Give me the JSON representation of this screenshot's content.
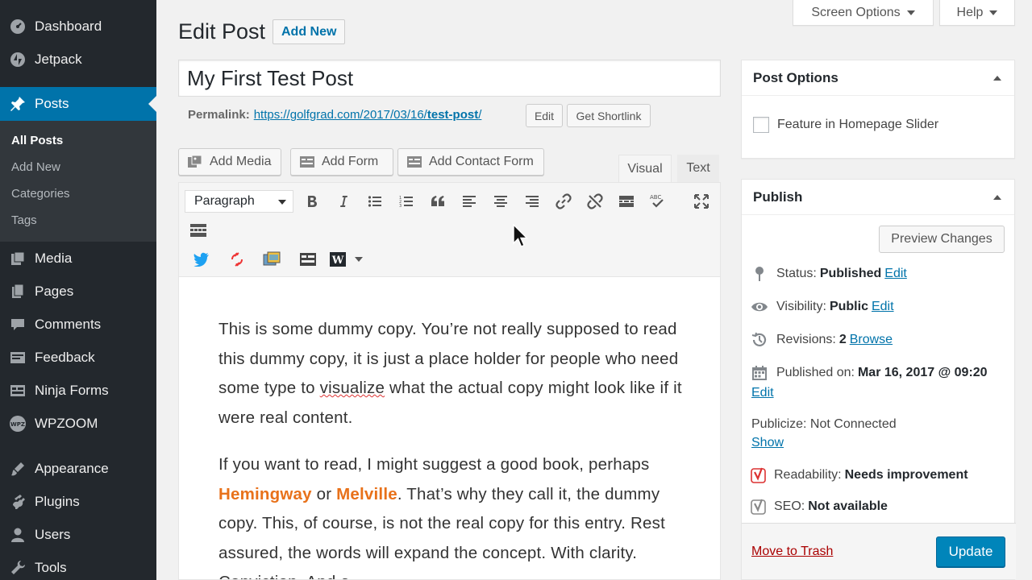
{
  "sidebar": {
    "items": [
      {
        "label": "Dashboard",
        "icon": "dashboard-icon"
      },
      {
        "label": "Jetpack",
        "icon": "jetpack-icon"
      },
      {
        "label": "Posts",
        "icon": "pin-icon"
      },
      {
        "label": "Media",
        "icon": "media-icon"
      },
      {
        "label": "Pages",
        "icon": "pages-icon"
      },
      {
        "label": "Comments",
        "icon": "comments-icon"
      },
      {
        "label": "Feedback",
        "icon": "feedback-icon"
      },
      {
        "label": "Ninja Forms",
        "icon": "forms-icon"
      },
      {
        "label": "WPZOOM",
        "icon": "wpzoom-icon"
      },
      {
        "label": "Appearance",
        "icon": "appearance-icon"
      },
      {
        "label": "Plugins",
        "icon": "plugins-icon"
      },
      {
        "label": "Users",
        "icon": "users-icon"
      },
      {
        "label": "Tools",
        "icon": "tools-icon"
      }
    ],
    "submenu": [
      "All Posts",
      "Add New",
      "Categories",
      "Tags"
    ]
  },
  "topbar": {
    "screen_options": "Screen Options",
    "help": "Help"
  },
  "header": {
    "title": "Edit Post",
    "add_new": "Add New"
  },
  "post": {
    "title": "My First Test Post",
    "permalink_label": "Permalink:",
    "permalink_base": "https://golfgrad.com/2017/03/16/",
    "permalink_slug": "test-post",
    "permalink_end": "/",
    "edit_btn": "Edit",
    "shortlink_btn": "Get Shortlink"
  },
  "media_buttons": {
    "add_media": "Add Media",
    "add_form": "Add Form",
    "add_contact_form": "Add Contact Form"
  },
  "editor_tabs": {
    "visual": "Visual",
    "text": "Text"
  },
  "toolbar": {
    "format": "Paragraph",
    "wp_label": "W"
  },
  "content": {
    "p1_a": "This is some dummy copy. You’re not really supposed to read this dummy copy, it is just a place holder for people who need some type to ",
    "p1_squiggle": "visualize",
    "p1_b": " what the actual copy might look like if it were real content.",
    "p2_a": "If you want to read, I might suggest a good book, perhaps ",
    "p2_hem": "Hemingway",
    "p2_or": " or ",
    "p2_mel": "Melville",
    "p2_b": ". That’s why they call it, the dummy copy. This, of course, is not the real copy for this entry. Rest assured, the words will expand the concept. With clarity. Conviction. And a"
  },
  "post_options": {
    "title": "Post Options",
    "feature_label": "Feature in Homepage Slider"
  },
  "publish": {
    "title": "Publish",
    "preview": "Preview Changes",
    "status_label": "Status:",
    "status_value": "Published",
    "status_edit": "Edit",
    "visibility_label": "Visibility:",
    "visibility_value": "Public",
    "visibility_edit": "Edit",
    "revisions_label": "Revisions:",
    "revisions_value": "2",
    "revisions_browse": "Browse",
    "published_label": "Published on:",
    "published_value": "Mar 16, 2017 @ 09:20",
    "published_edit": "Edit",
    "publicize": "Publicize: Not Connected",
    "publicize_show": "Show",
    "readability_label": "Readability:",
    "readability_value": "Needs improvement",
    "seo_label": "SEO:",
    "seo_value": "Not available",
    "move_trash": "Move to Trash",
    "update": "Update"
  },
  "colors": {
    "admin_dark": "#23282d",
    "accent": "#0073aa",
    "primary_button": "#0085ba",
    "trash": "#a00",
    "orange": "#e8711a",
    "yoast_red": "#dc3232"
  }
}
